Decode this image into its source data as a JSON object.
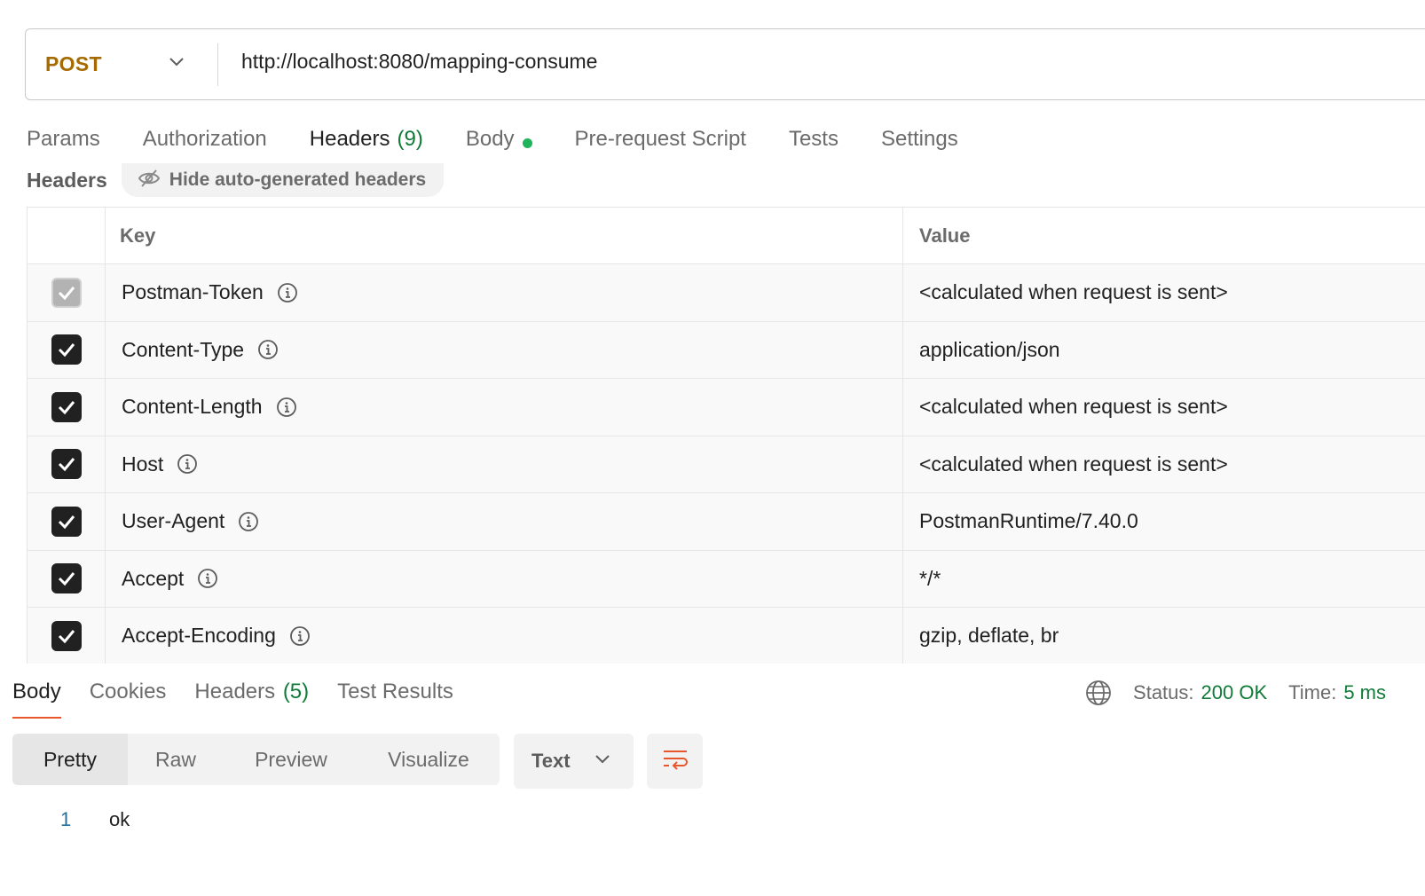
{
  "request": {
    "method": "POST",
    "url": "http://localhost:8080/mapping-consume"
  },
  "request_tabs": [
    {
      "label": "Params",
      "count": "",
      "active": false
    },
    {
      "label": "Authorization",
      "count": "",
      "active": false
    },
    {
      "label": "Headers",
      "count": "(9)",
      "active": true
    },
    {
      "label": "Body",
      "count": "",
      "active": false,
      "dot": true
    },
    {
      "label": "Pre-request Script",
      "count": "",
      "active": false
    },
    {
      "label": "Tests",
      "count": "",
      "active": false
    },
    {
      "label": "Settings",
      "count": "",
      "active": false
    }
  ],
  "headers_section": {
    "title": "Headers",
    "toggle_label": "Hide auto-generated headers"
  },
  "table": {
    "columns": {
      "key": "Key",
      "value": "Value"
    },
    "rows": [
      {
        "key": "Postman-Token",
        "value": "<calculated when request is sent>",
        "checked": true,
        "disabled": true
      },
      {
        "key": "Content-Type",
        "value": "application/json",
        "checked": true,
        "disabled": false
      },
      {
        "key": "Content-Length",
        "value": "<calculated when request is sent>",
        "checked": true,
        "disabled": false
      },
      {
        "key": "Host",
        "value": "<calculated when request is sent>",
        "checked": true,
        "disabled": false
      },
      {
        "key": "User-Agent",
        "value": "PostmanRuntime/7.40.0",
        "checked": true,
        "disabled": false
      },
      {
        "key": "Accept",
        "value": "*/*",
        "checked": true,
        "disabled": false
      },
      {
        "key": "Accept-Encoding",
        "value": "gzip, deflate, br",
        "checked": true,
        "disabled": false
      }
    ]
  },
  "response": {
    "tabs": [
      {
        "label": "Body",
        "count": "",
        "active": true
      },
      {
        "label": "Cookies",
        "count": "",
        "active": false
      },
      {
        "label": "Headers",
        "count": "(5)",
        "active": false
      },
      {
        "label": "Test Results",
        "count": "",
        "active": false
      }
    ],
    "status_label": "Status:",
    "status_value": "200 OK",
    "time_label": "Time:",
    "time_value": "5 ms",
    "view_modes": [
      "Pretty",
      "Raw",
      "Preview",
      "Visualize"
    ],
    "active_view": "Pretty",
    "format": "Text",
    "body_lines": [
      {
        "line": "1",
        "text": "ok"
      }
    ]
  },
  "colors": {
    "accent": "#e8562b",
    "method": "#a66b00",
    "success": "#0f7b37",
    "dot": "#1fb35a"
  },
  "icons": [
    "chevron-down-icon",
    "eye-off-icon",
    "info-icon",
    "check-icon",
    "globe-icon",
    "wrap-lines-icon"
  ]
}
